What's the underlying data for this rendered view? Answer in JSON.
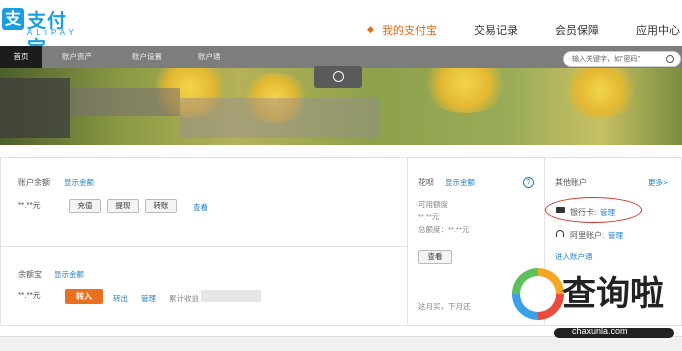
{
  "header": {
    "logo_cn": "支付宝",
    "logo_en": "ALIPAY",
    "nav": [
      "我的支付宝",
      "交易记录",
      "会员保障",
      "应用中心"
    ]
  },
  "subnav": {
    "items": [
      "首页",
      "账户资产",
      "账户设置",
      "账户通"
    ],
    "search_placeholder": "输入关键字，如\"密码\""
  },
  "balance": {
    "label": "账户余额",
    "show": "显示金额",
    "amount": "**.**元",
    "buttons": [
      "充值",
      "提现",
      "转账"
    ],
    "view": "查看"
  },
  "yuebao": {
    "label": "余额宝",
    "show": "显示金额",
    "amount": "**.**元",
    "transfer_in": "转入",
    "transfer_out": "转出",
    "manage": "管理",
    "income": "累计收益"
  },
  "huabei": {
    "label": "花呗",
    "show": "显示金额",
    "available_label": "可用额度",
    "available": "**.**元",
    "total_label": "总额度：**.**元",
    "view": "查看",
    "footer": "这月买，下月还"
  },
  "other_accounts": {
    "title": "其他账户",
    "more": "更多>",
    "bank_card": "银行卡:",
    "bank_manage": "管理",
    "ali_account": "阿里账户:",
    "ali_manage": "管理",
    "enter": "进入账户通"
  },
  "watermark": {
    "text": "查询啦",
    "url": "chaxunla.com"
  },
  "colors": {
    "brand": "#1a9ee0",
    "accent": "#e06a1a",
    "link": "#1a7fcb",
    "highlight": "#d8322a"
  }
}
